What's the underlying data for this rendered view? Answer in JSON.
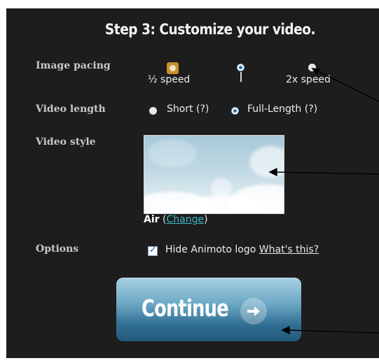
{
  "step_title": "Step 3: Customize your video.",
  "image_pacing": {
    "label": "Image pacing",
    "half_speed": "½ speed",
    "double_speed": "2x speed"
  },
  "video_length": {
    "label": "Video length",
    "options": [
      {
        "label": "Short (?)",
        "selected": false
      },
      {
        "label": "Full-Length (?)",
        "selected": true
      }
    ]
  },
  "video_style": {
    "label": "Video style",
    "style_name": "Air",
    "change_open": "(",
    "change_link": "Change",
    "change_close": ")"
  },
  "options": {
    "label": "Options",
    "hide_logo": "Hide Animoto logo",
    "hide_logo_checked": true,
    "whats_this": "What's this?"
  },
  "continue_button": {
    "label": "Continue"
  },
  "colors": {
    "background": "#1d1d1d",
    "accent_blue": "#2f6e92",
    "link_teal": "#3fb7c9"
  }
}
